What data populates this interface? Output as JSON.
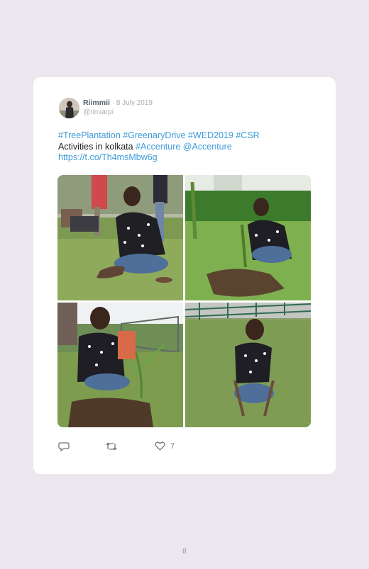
{
  "tweet": {
    "author_name": "Riimmii",
    "separator": " · ",
    "date": "8 July 2019",
    "handle": "@rimiarpi",
    "line1": "#TreePlantation #GreenaryDrive #WED2019 #CSR",
    "line2_plain": "Activities in kolkata ",
    "line2_link": "#Accenture @Accenture",
    "line3_link": "https://t.co/Th4msMbw6g",
    "photos": [
      "photo-1",
      "photo-2",
      "photo-3",
      "photo-4"
    ]
  },
  "actions": {
    "reply_icon": "reply-icon",
    "retweet_icon": "retweet-icon",
    "like_icon": "heart-icon",
    "like_count": "7"
  },
  "page": {
    "number": "8"
  },
  "colors": {
    "link": "#3f9bd9",
    "background": "#ece6ee",
    "card": "#ffffff"
  }
}
